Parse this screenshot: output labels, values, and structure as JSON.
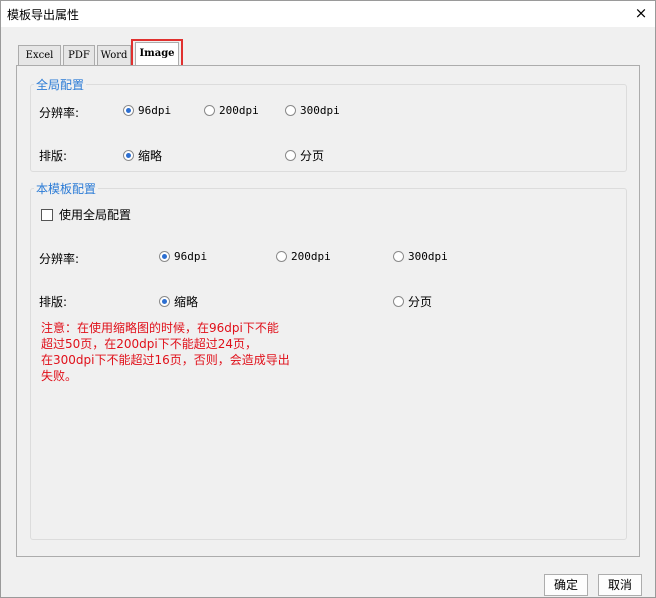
{
  "window": {
    "title": "模板导出属性",
    "close_icon": "×"
  },
  "tabs": [
    {
      "label": "Excel",
      "active": false
    },
    {
      "label": "PDF",
      "active": false
    },
    {
      "label": "Word",
      "active": false
    },
    {
      "label": "Image",
      "active": true
    }
  ],
  "global_config": {
    "title": "全局配置",
    "resolution_label": "分辨率:",
    "resolution_options": [
      "96dpi",
      "200dpi",
      "300dpi"
    ],
    "resolution_selected": "96dpi",
    "layout_label": "排版:",
    "layout_options": [
      "缩略",
      "分页"
    ],
    "layout_selected": "缩略"
  },
  "template_config": {
    "title": "本模板配置",
    "use_global_label": "使用全局配置",
    "use_global_checked": false,
    "resolution_label": "分辨率:",
    "resolution_options": [
      "96dpi",
      "200dpi",
      "300dpi"
    ],
    "resolution_selected": "96dpi",
    "layout_label": "排版:",
    "layout_options": [
      "缩略",
      "分页"
    ],
    "layout_selected": "缩略",
    "note": "注意：在使用缩略图的时候，在96dpi下不能\n超过50页，在200dpi下不能超过24页，\n在300dpi下不能超过16页，否则，会造成导出\n失败。"
  },
  "buttons": {
    "ok": "确定",
    "cancel": "取消"
  },
  "colors": {
    "legend": "#2b7bd6",
    "note": "#e0101a",
    "highlight": "#e0312f",
    "radio_selected": "#2d6fd1"
  }
}
